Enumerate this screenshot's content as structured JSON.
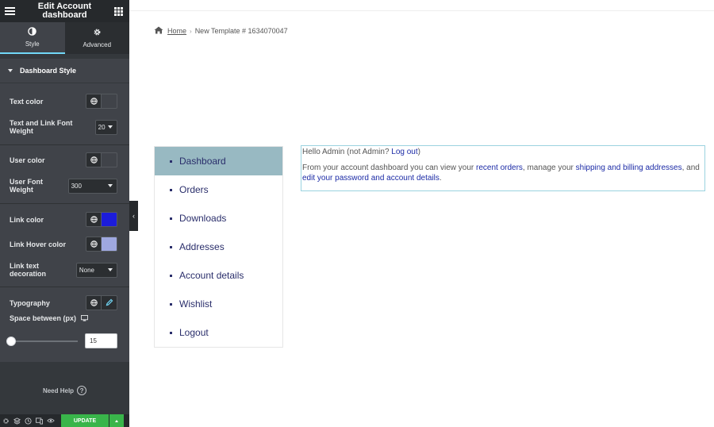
{
  "panel": {
    "title": "Edit Account dashboard",
    "tabs": [
      {
        "label": "Style",
        "icon": "half-circle-icon",
        "active": true
      },
      {
        "label": "Advanced",
        "icon": "gear-icon",
        "active": false
      }
    ],
    "section_title": "Dashboard Style",
    "controls": {
      "text_color": {
        "label": "Text color",
        "color": "#404349"
      },
      "text_link_font_weight": {
        "label": "Text and Link Font Weight",
        "value": "20"
      },
      "user_color": {
        "label": "User color",
        "color": "#404349"
      },
      "user_font_weight": {
        "label": "User Font Weight",
        "value": "300"
      },
      "link_color": {
        "label": "Link color",
        "color": "#1c1cd9"
      },
      "link_hover_color": {
        "label": "Link Hover color",
        "color": "#9fa8e0"
      },
      "link_text_decoration": {
        "label": "Link text decoration",
        "value": "None"
      },
      "typography": {
        "label": "Typography"
      },
      "space_between": {
        "label": "Space between (px)",
        "value": "15",
        "slider_fraction": 0.0
      }
    },
    "need_help": "Need Help",
    "update_label": "UPDATE"
  },
  "preview": {
    "breadcrumb": {
      "home": "Home",
      "current": "New Template # 1634070047"
    },
    "nav": [
      {
        "label": "Dashboard",
        "active": true
      },
      {
        "label": "Orders",
        "active": false
      },
      {
        "label": "Downloads",
        "active": false
      },
      {
        "label": "Addresses",
        "active": false
      },
      {
        "label": "Account details",
        "active": false
      },
      {
        "label": "Wishlist",
        "active": false
      },
      {
        "label": "Logout",
        "active": false
      }
    ],
    "content": {
      "hello_prefix": "Hello Admin (not Admin? ",
      "logout_link": "Log out",
      "hello_suffix": ")",
      "p2_part1": "From your account dashboard you can view your ",
      "recent_orders": "recent orders",
      "p2_part2": ", manage your ",
      "shipping_billing": "shipping and billing addresses",
      "p2_part3": ", and ",
      "edit_password": "edit your password and account details",
      "p2_part4": "."
    }
  },
  "colors": {
    "accent_tab": "#71d7f7",
    "update_green": "#39b54a",
    "nav_active": "#98b9c2",
    "link": "#1c2ba6"
  }
}
